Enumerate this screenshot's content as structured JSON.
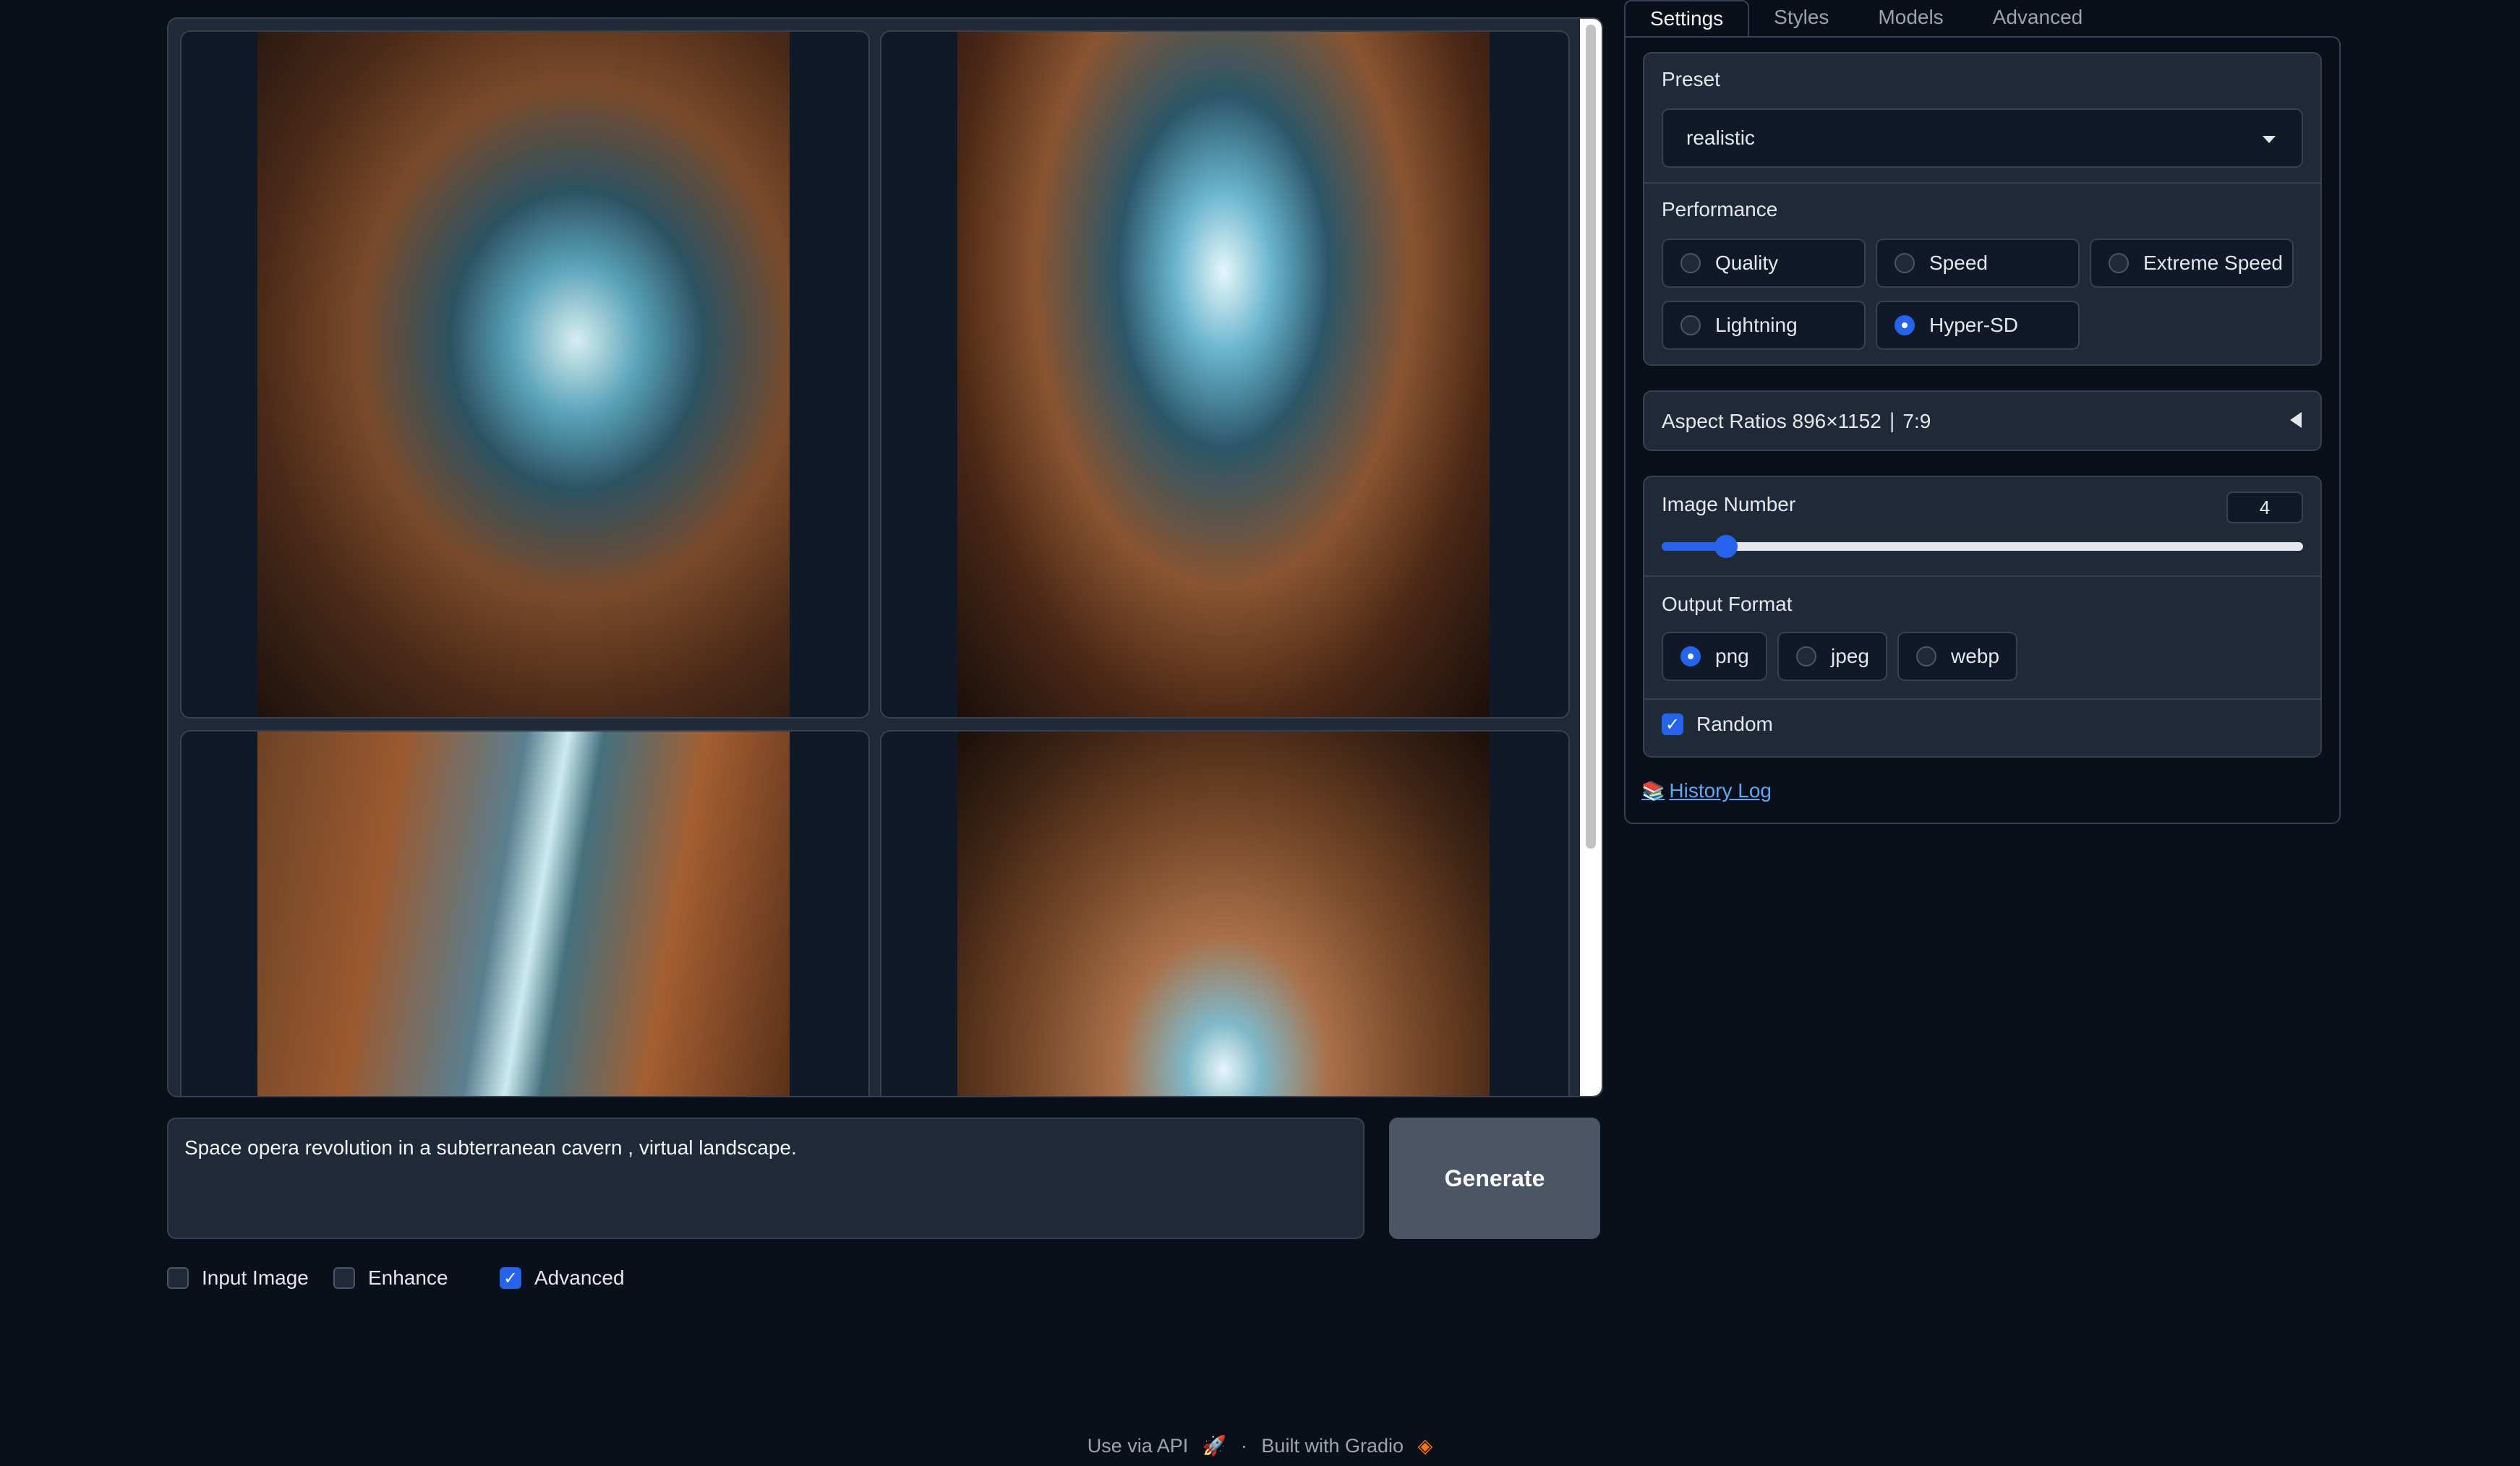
{
  "gallery": {
    "images": [
      {
        "alt": "cave-1",
        "gradient": "radial-gradient(ellipse at 60% 45%, #d8eef0 0%, #5aa3b8 14%, #2c5262 28%, #7a4a2a 48%, #4a2a18 70%, #1e120c 100%)"
      },
      {
        "alt": "cave-2",
        "gradient": "radial-gradient(ellipse at 50% 35%, #e6f7fa 0%, #68b4cc 13%, #2b5668 28%, #8a5430 50%, #4a2816 72%, #1a0f0a 100%)"
      },
      {
        "alt": "cave-3",
        "gradient": "linear-gradient(100deg, #6e4224 0%, #9a5a30 25%, #5a7f90 45%, #cdeaf0 52%, #44707e 58%, #a35f32 75%, #5a3018 100%)"
      },
      {
        "alt": "cave-4",
        "gradient": "radial-gradient(ellipse at 50% 90%, #e8f6fa 0%, #7fb8c8 10%, #a87048 28%, #7a4a2a 50%, #3e2414 78%, #1a0f0a 100%)"
      }
    ]
  },
  "prompt": {
    "value": "Space opera revolution in a subterranean cavern , virtual landscape."
  },
  "generate_label": "Generate",
  "toggles": [
    {
      "label": "Input Image",
      "checked": false
    },
    {
      "label": "Enhance",
      "checked": false
    },
    {
      "label": "Advanced",
      "checked": true
    }
  ],
  "tabs": [
    "Settings",
    "Styles",
    "Models",
    "Advanced"
  ],
  "settings": {
    "preset_label": "Preset",
    "preset_value": "realistic",
    "performance_label": "Performance",
    "performance_options": [
      "Quality",
      "Speed",
      "Extreme Speed",
      "Lightning",
      "Hyper-SD"
    ],
    "performance_selected": "Hyper-SD",
    "aspect_ratios": "Aspect Ratios 896×1152 ∣ 7:9",
    "image_number_label": "Image Number",
    "image_number_value": "4",
    "image_number_fraction": 0.1,
    "output_format_label": "Output Format",
    "output_formats": [
      "png",
      "jpeg",
      "webp"
    ],
    "output_format_selected": "png",
    "random_label": "Random",
    "random_checked": true
  },
  "history_log": "History Log",
  "footer": {
    "api": "Use via API",
    "separator": "·",
    "built": "Built with Gradio"
  },
  "colors": {
    "background": "#0b0f19",
    "panel": "#1f2937",
    "accent": "#2563eb",
    "link": "#60a5fa"
  }
}
